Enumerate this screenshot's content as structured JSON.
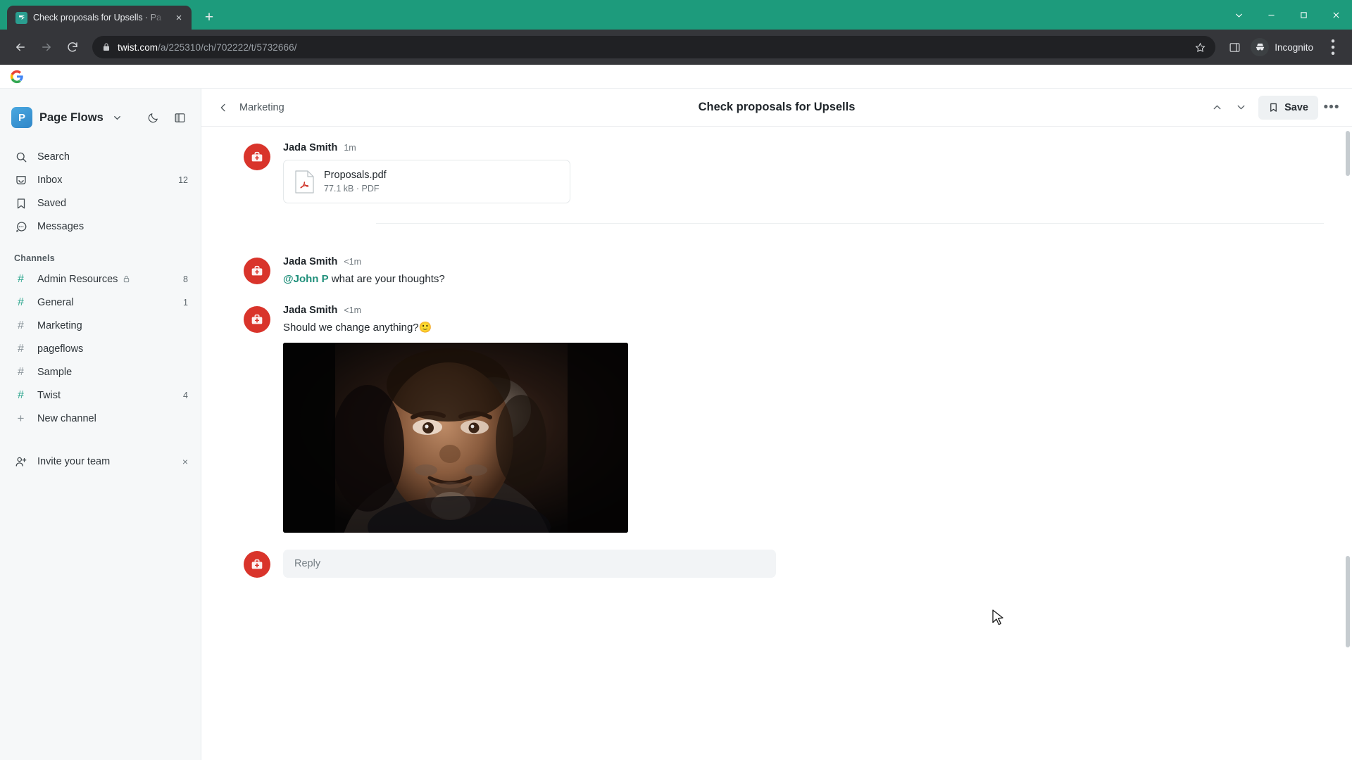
{
  "browser": {
    "tab": {
      "title": "Check proposals for Upsells · Pa",
      "favicon": "twist-icon",
      "close": "×"
    },
    "new_tab_label": "+",
    "window_controls": [
      "chevron-down-icon",
      "minimize-icon",
      "maximize-icon",
      "close-icon"
    ],
    "nav": {
      "back": "back-arrow-icon",
      "forward": "forward-arrow-icon",
      "reload": "reload-icon"
    },
    "address": {
      "lock": "lock-icon",
      "domain": "twist.com",
      "path": "/a/225310/ch/702222/t/5732666/"
    },
    "bookmark_star": "star-icon",
    "side_panel": "side-panel-icon",
    "profile": {
      "label": "Incognito",
      "icon": "incognito-icon"
    },
    "menu": "three-dot-menu-icon",
    "bookmarks_bar": {
      "google_icon": "google-g-icon"
    },
    "colors": {
      "tabbar": "#1d9b7c",
      "toolbar": "#35363a",
      "omnibox": "#202124"
    }
  },
  "sidebar": {
    "workspace": {
      "initial": "P",
      "name": "Page Flows",
      "chevron": "chevron-down-icon"
    },
    "actions": [
      {
        "name": "dark-mode-toggle",
        "icon": "moon-icon"
      },
      {
        "name": "panel-toggle",
        "icon": "panel-layout-icon"
      }
    ],
    "nav": [
      {
        "label": "Search",
        "icon": "search-icon",
        "badge": ""
      },
      {
        "label": "Inbox",
        "icon": "inbox-icon",
        "badge": "12"
      },
      {
        "label": "Saved",
        "icon": "bookmark-icon",
        "badge": ""
      },
      {
        "label": "Messages",
        "icon": "chat-bubble-icon",
        "badge": ""
      }
    ],
    "channels_title": "Channels",
    "channels": [
      {
        "label": "Admin Resources",
        "badge": "8",
        "unread": true,
        "private": true
      },
      {
        "label": "General",
        "badge": "1",
        "unread": true,
        "private": false
      },
      {
        "label": "Marketing",
        "badge": "",
        "unread": false,
        "private": false
      },
      {
        "label": "pageflows",
        "badge": "",
        "unread": false,
        "private": false
      },
      {
        "label": "Sample",
        "badge": "",
        "unread": false,
        "private": false
      },
      {
        "label": "Twist",
        "badge": "4",
        "unread": true,
        "private": false
      }
    ],
    "new_channel": {
      "label": "New channel",
      "icon": "plus-icon"
    },
    "invite": {
      "label": "Invite your team",
      "icon": "add-person-icon",
      "dismiss": "×"
    }
  },
  "thread": {
    "breadcrumb": "Marketing",
    "back_icon": "chevron-left-icon",
    "title": "Check proposals for Upsells",
    "nav_up": "chevron-up-icon",
    "nav_down": "chevron-down-icon",
    "save_label": "Save",
    "save_icon": "bookmark-icon",
    "more_icon": "ellipsis-icon",
    "messages": [
      {
        "author": "Jada Smith",
        "time": "1m",
        "avatar": "first-aid-kit-avatar",
        "text": "",
        "attachment": {
          "name": "Proposals.pdf",
          "meta": "77.1 kB · PDF",
          "icon": "pdf-file-icon"
        }
      },
      {
        "author": "Jada Smith",
        "time": "<1m",
        "avatar": "first-aid-kit-avatar",
        "mention": "@John P",
        "text": " what are your thoughts?"
      },
      {
        "author": "Jada Smith",
        "time": "<1m",
        "avatar": "first-aid-kit-avatar",
        "text": "Should we change anything?🙂",
        "media": "embedded-gif-thumbnail"
      }
    ],
    "reply_placeholder": "Reply"
  }
}
